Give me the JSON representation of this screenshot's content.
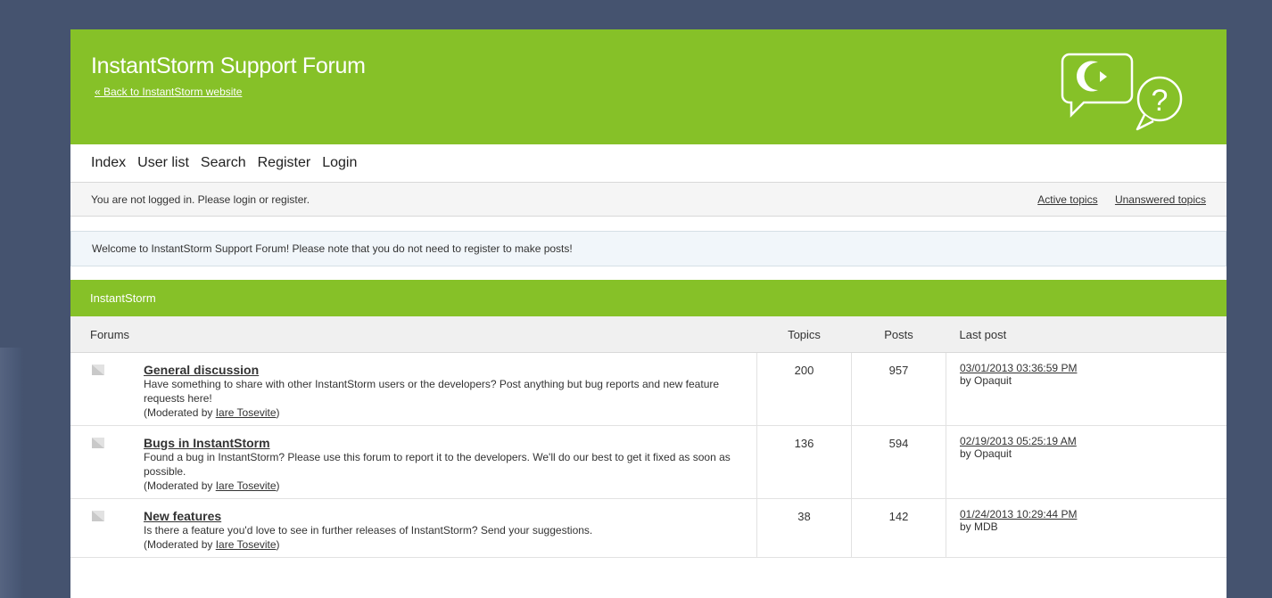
{
  "header": {
    "title": "InstantStorm Support Forum",
    "back_link": "« Back to InstantStorm website",
    "logo_icon": "chat-bubbles-logo-icon"
  },
  "nav": {
    "items": [
      "Index",
      "User list",
      "Search",
      "Register",
      "Login"
    ]
  },
  "status": {
    "message": "You are not logged in. Please login or register.",
    "links": [
      "Active topics",
      "Unanswered topics"
    ]
  },
  "announcement": "Welcome to InstantStorm Support Forum! Please note that you do not need to register to make posts!",
  "category": {
    "name": "InstantStorm",
    "columns": {
      "forums": "Forums",
      "topics": "Topics",
      "posts": "Posts",
      "last_post": "Last post"
    },
    "forums": [
      {
        "name": "General discussion",
        "description": "Have something to share with other InstantStorm users or the developers? Post anything but bug reports and new feature requests here!",
        "mod_prefix": "(Moderated by ",
        "moderator": "Iare Tosevite",
        "mod_suffix": ")",
        "topics": "200",
        "posts": "957",
        "last_post_date": "03/01/2013 03:36:59 PM",
        "last_post_by": "by Opaquit"
      },
      {
        "name": "Bugs in InstantStorm",
        "description": "Found a bug in InstantStorm? Please use this forum to report it to the developers. We'll do our best to get it fixed as soon as possible.",
        "mod_prefix": "(Moderated by ",
        "moderator": "Iare Tosevite",
        "mod_suffix": ")",
        "topics": "136",
        "posts": "594",
        "last_post_date": "02/19/2013 05:25:19 AM",
        "last_post_by": "by Opaquit"
      },
      {
        "name": "New features",
        "description": "Is there a feature you'd love to see in further releases of InstantStorm? Send your suggestions.",
        "mod_prefix": "(Moderated by ",
        "moderator": "Iare Tosevite",
        "mod_suffix": ")",
        "topics": "38",
        "posts": "142",
        "last_post_date": "01/24/2013 10:29:44 PM",
        "last_post_by": "by MDB"
      }
    ]
  },
  "colors": {
    "accent": "#86c128",
    "background": "#45536f"
  }
}
